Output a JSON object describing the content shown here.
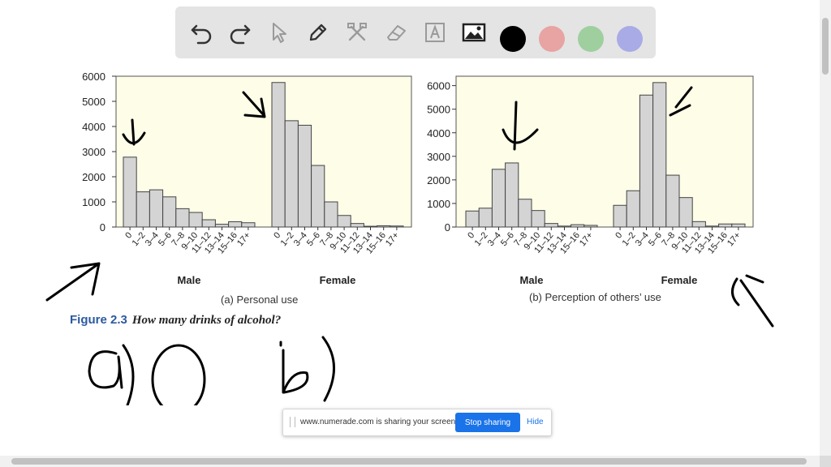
{
  "toolbar": {
    "tools": [
      "undo-icon",
      "redo-icon",
      "select-icon",
      "pen-icon",
      "tools-icon",
      "eraser-icon",
      "text-icon",
      "image-icon"
    ],
    "colors": [
      "#000000",
      "#e8a3a3",
      "#9fcf9f",
      "#a9abe6"
    ]
  },
  "charts": {
    "panel_bg": "#fefde8",
    "bar_fill": "#d4d4d4",
    "captions": {
      "a": "(a) Personal use",
      "b": "(b) Perception of others’ use"
    },
    "group_labels": [
      "Male",
      "Female"
    ]
  },
  "figure": {
    "number": "Figure 2.3",
    "title": "How many drinks of alcohol?"
  },
  "chart_data": [
    {
      "type": "bar",
      "title": "(a) Personal use",
      "categories": [
        "0",
        "1–2",
        "3–4",
        "5–6",
        "7–8",
        "9–10",
        "11–12",
        "13–14",
        "15–16",
        "17+"
      ],
      "groups": [
        "Male",
        "Female"
      ],
      "series": [
        {
          "name": "Male",
          "values": [
            2780,
            1400,
            1480,
            1200,
            730,
            580,
            290,
            110,
            210,
            170
          ]
        },
        {
          "name": "Female",
          "values": [
            5750,
            4230,
            4050,
            2450,
            1000,
            460,
            140,
            30,
            50,
            40
          ]
        }
      ],
      "yticks": [
        0,
        1000,
        2000,
        3000,
        4000,
        5000,
        6000
      ],
      "ylim": [
        0,
        6000
      ]
    },
    {
      "type": "bar",
      "title": "(b) Perception of others’ use",
      "categories": [
        "0",
        "1–2",
        "3–4",
        "5–6",
        "7–8",
        "9–10",
        "11–12",
        "13–14",
        "15–16",
        "17+"
      ],
      "groups": [
        "Male",
        "Female"
      ],
      "series": [
        {
          "name": "Male",
          "values": [
            680,
            800,
            2450,
            2720,
            1180,
            700,
            150,
            40,
            100,
            70
          ]
        },
        {
          "name": "Female",
          "values": [
            920,
            1540,
            5600,
            6130,
            2200,
            1250,
            230,
            40,
            130,
            130
          ]
        }
      ],
      "yticks": [
        0,
        1000,
        2000,
        3000,
        4000,
        5000,
        6000
      ],
      "ylim": [
        0,
        6400
      ]
    }
  ],
  "share_bar": {
    "message": "www.numerade.com is sharing your screen.",
    "stop_label": "Stop sharing",
    "hide_label": "Hide"
  }
}
